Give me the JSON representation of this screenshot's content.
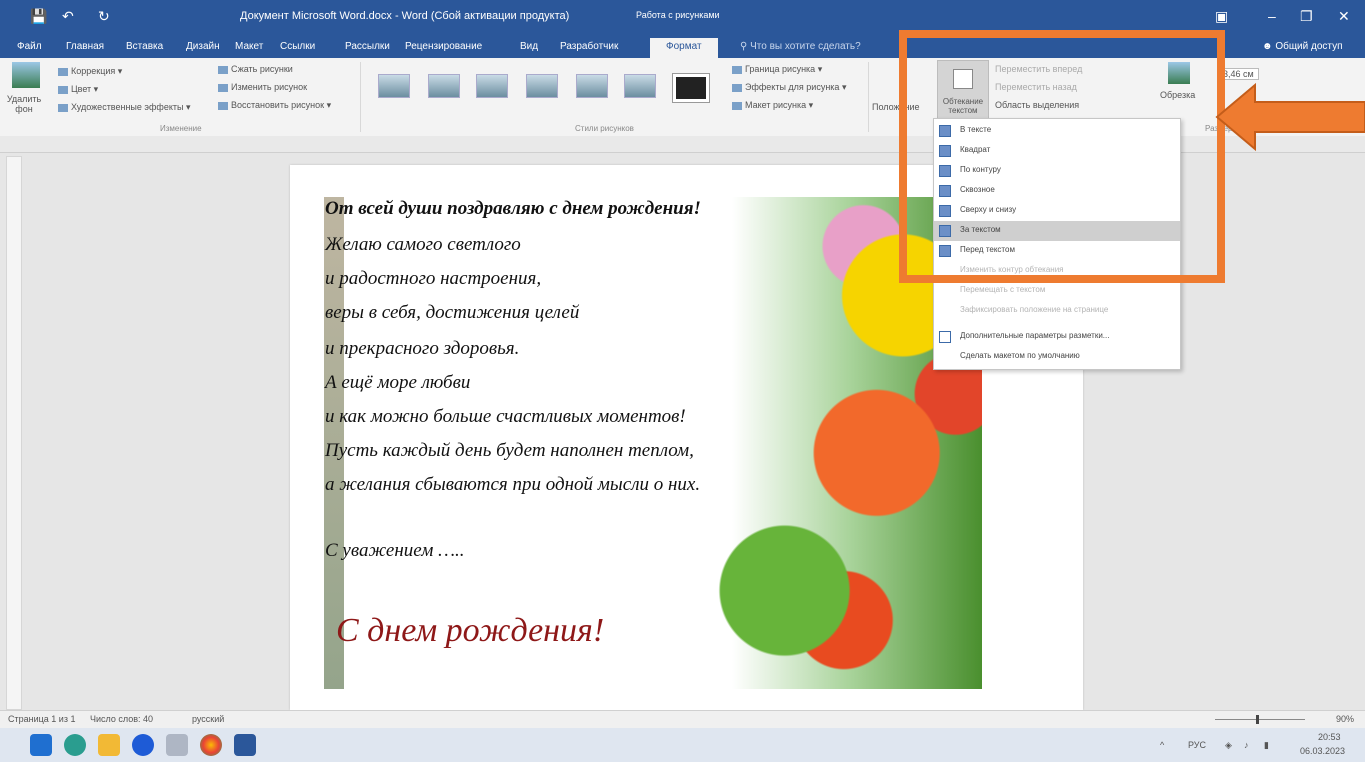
{
  "window": {
    "title": "Документ Microsoft Word.docx - Word (Сбой активации продукта)",
    "context_tab_group": "Работа с рисунками"
  },
  "tabs": [
    "Файл",
    "Главная",
    "Вставка",
    "Дизайн",
    "Макет",
    "Ссылки",
    "Рассылки",
    "Рецензирование",
    "Вид",
    "Разработчик",
    "Формат"
  ],
  "tell_me": "Что вы хотите сделать?",
  "share_label": "Общий доступ",
  "ribbon": {
    "remove_bg": "Удалить фон",
    "corrections": "Коррекция",
    "color": "Цвет",
    "artistic": "Художественные эффекты",
    "compress": "Сжать рисунки",
    "change": "Изменить рисунок",
    "reset": "Восстановить рисунок",
    "group_change": "Изменение",
    "group_styles": "Стили рисунков",
    "border": "Граница рисунка",
    "effects": "Эффекты для рисунка",
    "layout": "Макет рисунка",
    "position": "Положение",
    "wrap": "Обтекание текстом",
    "bring_forward": "Переместить вперед",
    "send_backward": "Переместить назад",
    "selection_pane": "Область выделения",
    "crop": "Обрезка",
    "width_value": "3,46 см",
    "group_size": "Размер"
  },
  "wrap_menu": {
    "items": [
      {
        "label": "В тексте",
        "disabled": false
      },
      {
        "label": "Квадрат",
        "disabled": false
      },
      {
        "label": "По контуру",
        "disabled": false
      },
      {
        "label": "Сквозное",
        "disabled": false
      },
      {
        "label": "Сверху и снизу",
        "disabled": false
      },
      {
        "label": "За текстом",
        "disabled": false,
        "highlighted": true
      },
      {
        "label": "Перед текстом",
        "disabled": false
      },
      {
        "label": "Изменить контур обтекания",
        "disabled": true
      },
      {
        "label": "Перемещать с текстом",
        "disabled": true
      },
      {
        "label": "Зафиксировать положение на странице",
        "disabled": true
      },
      {
        "label": "Дополнительные параметры разметки...",
        "disabled": false
      },
      {
        "label": "Сделать макетом по умолчанию",
        "disabled": false
      }
    ]
  },
  "document": {
    "lines": [
      "От всей души поздравляю с днем рождения!",
      "Желаю самого светлого",
      "и радостного настроения,",
      "веры в себя, достижения целей",
      "и прекрасного здоровья.",
      "А ещё море любви",
      "и как можно больше счастливых моментов!",
      "Пусть каждый день будет наполнен теплом,",
      "а желания сбываются при одной мысли о них.",
      "С уважением ….."
    ],
    "signature": "С днем рождения!"
  },
  "status": {
    "page": "Страница 1 из 1",
    "words": "Число слов: 40",
    "language": "русский",
    "zoom": "90%"
  },
  "taskbar": {
    "lang": "РУС",
    "time": "20:53",
    "date": "06.03.2023"
  },
  "colors": {
    "word_blue": "#2b579a",
    "annotation_orange": "#ee7b30"
  }
}
